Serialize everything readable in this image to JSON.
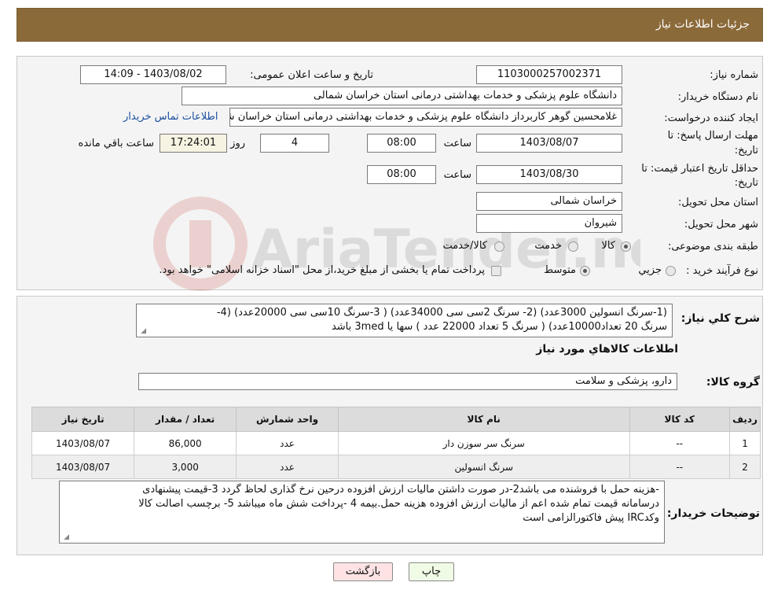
{
  "header": {
    "title": "جزئیات اطلاعات نیاز"
  },
  "watermark": {
    "text": "AriaTender.neT"
  },
  "form": {
    "need_number_label": "شماره نیاز:",
    "need_number": "1103000257002371",
    "announce_label": "تاریخ و ساعت اعلان عمومی:",
    "announce_value": "1403/08/02 - 14:09",
    "buyer_org_label": "نام دستگاه خریدار:",
    "buyer_org": "دانشگاه علوم پزشکی و خدمات بهداشتی درمانی استان خراسان شمالی",
    "creator_label": "ایجاد کننده درخواست:",
    "creator": "غلامحسین گوهر کاربرداز  دانشگاه علوم پزشکی و خدمات بهداشتی درمانی استان خراسان شمالی",
    "contact_link": "اطلاعات تماس خریدار",
    "deadline_label_1": "مهلت ارسال پاسخ: تا",
    "deadline_label_2": "تاریخ:",
    "deadline_date": "1403/08/07",
    "time_label": "ساعت",
    "deadline_time": "08:00",
    "days_value": "4",
    "days_label": "روز و",
    "remaining_time": "17:24:01",
    "remaining_label": "ساعت باقي مانده",
    "validity_label_1": "حداقل تاریخ اعتبار قیمت: تا",
    "validity_label_2": "تاریخ:",
    "validity_date": "1403/08/30",
    "validity_time": "08:00",
    "province_label": "استان محل تحویل:",
    "province": "خراسان شمالی",
    "city_label": "شهر محل تحویل:",
    "city": "شیروان",
    "category_label": "طبقه بندی موضوعی:",
    "category_options": [
      "کالا",
      "خدمت",
      "کالا/خدمت"
    ],
    "process_label": "نوع فرآیند خرید :",
    "process_options": [
      "جزیي",
      "متوسط"
    ],
    "process_note": "پرداخت تمام یا بخشی از مبلغ خرید،از محل \"اسناد خزانه اسلامی\" خواهد بود."
  },
  "details": {
    "summary_label": "شرح كلي نياز:",
    "summary_line1": "(1-سرنگ انسولین 3000عدد) (2- سرنگ 2سی سی 34000عدد) ( 3-سرنگ 10سی سی 20000عدد) (4-",
    "summary_line2": "سرنگ 20 تعداد10000عدد) ( سرنگ 5 تعداد 22000 عدد ) سها یا 3med باشد",
    "goods_info_title": "اطلاعات كالاهاي مورد نياز",
    "goods_group_label": "گروه کالا:",
    "goods_group": "دارو، پزشکی و سلامت",
    "table": {
      "headers": [
        "ردیف",
        "کد کالا",
        "نام کالا",
        "واحد شمارش",
        "تعداد / مقدار",
        "تاریخ نیاز"
      ],
      "rows": [
        [
          "1",
          "--",
          "سرنگ سر سوزن دار",
          "عدد",
          "86,000",
          "1403/08/07"
        ],
        [
          "2",
          "--",
          "سرنگ انسولین",
          "عدد",
          "3,000",
          "1403/08/07"
        ]
      ]
    },
    "buyer_notes_label": "توضیحات خریدار:",
    "buyer_notes_line1": "-هزینه حمل با فروشنده می باشد2-در صورت داشتن مالیات ارزش افزوده درحین نرخ گذاری لحاظ گردد 3-قیمت پیشنهادی",
    "buyer_notes_line2": "درسامانه  قیمت تمام شده اعم از مالیات ارزش افزوده هزینه حمل.بیمه 4 -پرداخت شش ماه میباشد 5- برچسب اصالت کالا",
    "buyer_notes_line3": "وکدIRC پیش فاکتورالزامی است"
  },
  "buttons": {
    "print": "چاپ",
    "back": "بازگشت"
  }
}
